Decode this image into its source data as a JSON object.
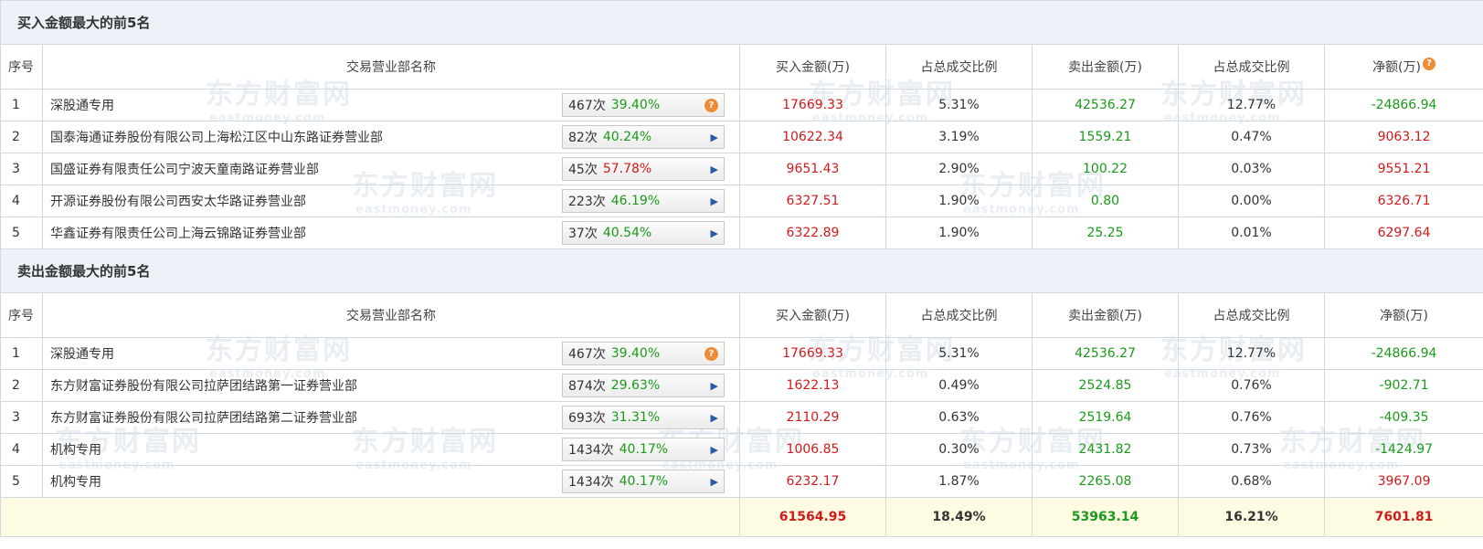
{
  "watermark": {
    "cn": "东方财富网",
    "en": "eastmoney.com"
  },
  "header": {
    "seq": "序号",
    "name": "交易营业部名称",
    "buy": "买入金额(万)",
    "buy_pct": "占总成交比例",
    "sell": "卖出金额(万)",
    "sell_pct": "占总成交比例",
    "net": "净额(万)"
  },
  "buy_top5": {
    "title": "买入金额最大的前5名",
    "rows": [
      {
        "seq": "1",
        "name": "深股通专用",
        "times": "467次",
        "rate": "39.40%",
        "rate_color": "green",
        "action": "help",
        "buy": "17669.33",
        "buy_pct": "5.31%",
        "sell": "42536.27",
        "sell_pct": "12.77%",
        "net": "-24866.94",
        "net_color": "green"
      },
      {
        "seq": "2",
        "name": "国泰海通证券股份有限公司上海松江区中山东路证券营业部",
        "times": "82次",
        "rate": "40.24%",
        "rate_color": "green",
        "action": "arrow",
        "buy": "10622.34",
        "buy_pct": "3.19%",
        "sell": "1559.21",
        "sell_pct": "0.47%",
        "net": "9063.12",
        "net_color": "red"
      },
      {
        "seq": "3",
        "name": "国盛证券有限责任公司宁波天童南路证券营业部",
        "times": "45次",
        "rate": "57.78%",
        "rate_color": "red",
        "action": "arrow",
        "buy": "9651.43",
        "buy_pct": "2.90%",
        "sell": "100.22",
        "sell_pct": "0.03%",
        "net": "9551.21",
        "net_color": "red"
      },
      {
        "seq": "4",
        "name": "开源证券股份有限公司西安太华路证券营业部",
        "times": "223次",
        "rate": "46.19%",
        "rate_color": "green",
        "action": "arrow",
        "buy": "6327.51",
        "buy_pct": "1.90%",
        "sell": "0.80",
        "sell_pct": "0.00%",
        "net": "6326.71",
        "net_color": "red"
      },
      {
        "seq": "5",
        "name": "华鑫证券有限责任公司上海云锦路证券营业部",
        "times": "37次",
        "rate": "40.54%",
        "rate_color": "green",
        "action": "arrow",
        "buy": "6322.89",
        "buy_pct": "1.90%",
        "sell": "25.25",
        "sell_pct": "0.01%",
        "net": "6297.64",
        "net_color": "red"
      }
    ]
  },
  "sell_top5": {
    "title": "卖出金额最大的前5名",
    "rows": [
      {
        "seq": "1",
        "name": "深股通专用",
        "times": "467次",
        "rate": "39.40%",
        "rate_color": "green",
        "action": "help",
        "buy": "17669.33",
        "buy_pct": "5.31%",
        "sell": "42536.27",
        "sell_pct": "12.77%",
        "net": "-24866.94",
        "net_color": "green"
      },
      {
        "seq": "2",
        "name": "东方财富证券股份有限公司拉萨团结路第一证券营业部",
        "times": "874次",
        "rate": "29.63%",
        "rate_color": "green",
        "action": "arrow",
        "buy": "1622.13",
        "buy_pct": "0.49%",
        "sell": "2524.85",
        "sell_pct": "0.76%",
        "net": "-902.71",
        "net_color": "green"
      },
      {
        "seq": "3",
        "name": "东方财富证券股份有限公司拉萨团结路第二证券营业部",
        "times": "693次",
        "rate": "31.31%",
        "rate_color": "green",
        "action": "arrow",
        "buy": "2110.29",
        "buy_pct": "0.63%",
        "sell": "2519.64",
        "sell_pct": "0.76%",
        "net": "-409.35",
        "net_color": "green"
      },
      {
        "seq": "4",
        "name": "机构专用",
        "times": "1434次",
        "rate": "40.17%",
        "rate_color": "green",
        "action": "arrow",
        "buy": "1006.85",
        "buy_pct": "0.30%",
        "sell": "2431.82",
        "sell_pct": "0.73%",
        "net": "-1424.97",
        "net_color": "green"
      },
      {
        "seq": "5",
        "name": "机构专用",
        "times": "1434次",
        "rate": "40.17%",
        "rate_color": "green",
        "action": "arrow",
        "buy": "6232.17",
        "buy_pct": "1.87%",
        "sell": "2265.08",
        "sell_pct": "0.68%",
        "net": "3967.09",
        "net_color": "red"
      }
    ]
  },
  "total": {
    "buy": "61564.95",
    "buy_pct": "18.49%",
    "sell": "53963.14",
    "sell_pct": "16.21%",
    "net": "7601.81"
  },
  "icons": {
    "help": "question-mark-icon",
    "arrow": "play-arrow-icon"
  },
  "colors": {
    "red": "#d11a1a",
    "green": "#1a9a1a",
    "section_bg": "#edf2f8",
    "total_bg": "#fefbe3",
    "border": "#cfd9e4",
    "help": "#f08a35"
  }
}
